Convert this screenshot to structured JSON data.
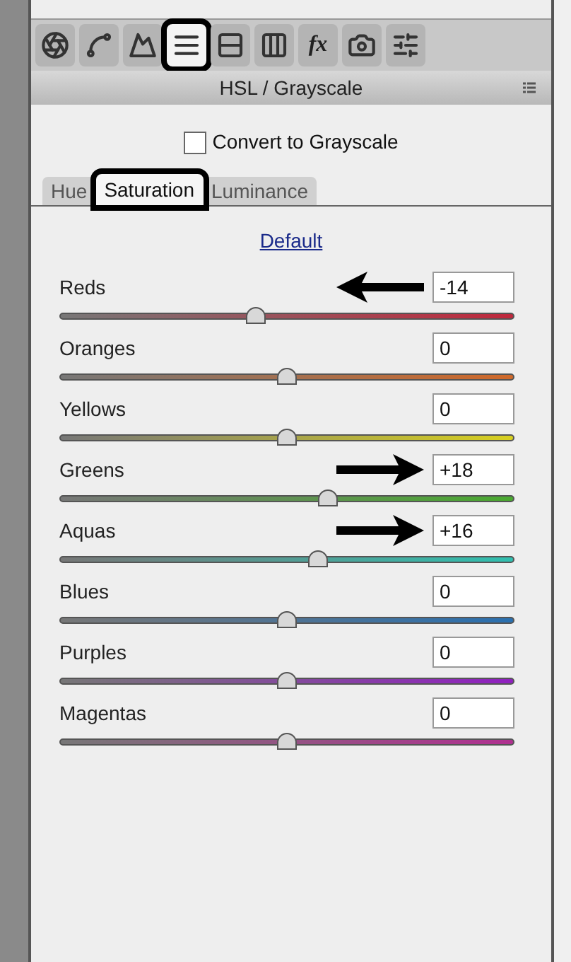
{
  "toolbar": [
    {
      "kind": "aperture",
      "selected": false,
      "highlighted": false
    },
    {
      "kind": "curve",
      "selected": false,
      "highlighted": false
    },
    {
      "kind": "mountain",
      "selected": false,
      "highlighted": false
    },
    {
      "kind": "lines",
      "selected": true,
      "highlighted": true
    },
    {
      "kind": "split",
      "selected": false,
      "highlighted": false
    },
    {
      "kind": "columns",
      "selected": false,
      "highlighted": false
    },
    {
      "kind": "text",
      "label": "fx",
      "selected": false,
      "highlighted": false
    },
    {
      "kind": "camera",
      "selected": false,
      "highlighted": false
    },
    {
      "kind": "sliders",
      "selected": false,
      "highlighted": false
    }
  ],
  "panel_title": "HSL / Grayscale",
  "grayscale": {
    "label": "Convert to Grayscale",
    "checked": false
  },
  "tabs": [
    {
      "label": "Hue",
      "selected": false,
      "highlighted": false
    },
    {
      "label": "Saturation",
      "selected": true,
      "highlighted": true
    },
    {
      "label": "Luminance",
      "selected": false,
      "highlighted": false
    }
  ],
  "default_link": "Default",
  "sliders": [
    {
      "name": "Reds",
      "value": "-14",
      "level": 0.43,
      "color": "#c0283c",
      "arrow_left": true
    },
    {
      "name": "Oranges",
      "value": "0",
      "level": 0.5,
      "color": "#d0692a"
    },
    {
      "name": "Yellows",
      "value": "0",
      "level": 0.5,
      "color": "#d8d020"
    },
    {
      "name": "Greens",
      "value": "+18",
      "level": 0.59,
      "color": "#4aaa30",
      "arrow_right": true
    },
    {
      "name": "Aquas",
      "value": "+16",
      "level": 0.57,
      "color": "#30c0b0",
      "arrow_right": true
    },
    {
      "name": "Blues",
      "value": "0",
      "level": 0.5,
      "color": "#2a70b0"
    },
    {
      "name": "Purples",
      "value": "0",
      "level": 0.5,
      "color": "#9020c0"
    },
    {
      "name": "Magentas",
      "value": "0",
      "level": 0.5,
      "color": "#b03090"
    }
  ]
}
